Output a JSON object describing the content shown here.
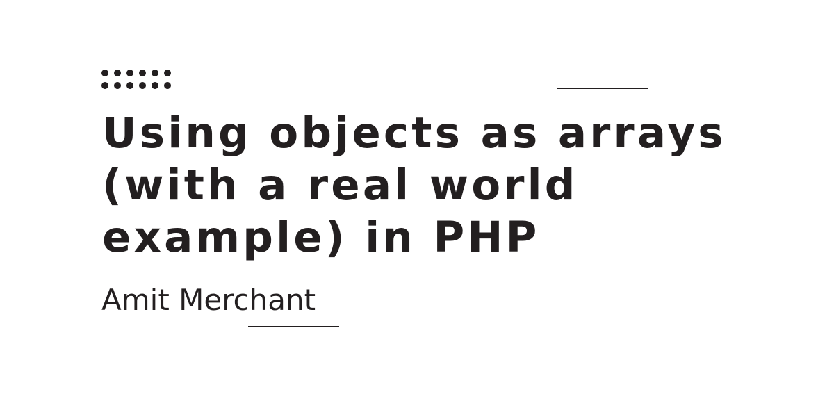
{
  "title_lines": [
    "Using objects as arrays",
    "(with a real world",
    "example) in PHP"
  ],
  "author": "Amit Merchant",
  "colors": {
    "background": "#ffffff",
    "text": "#231f20"
  },
  "decorations": {
    "dot_pattern_icon": "dot-grid-icon"
  }
}
